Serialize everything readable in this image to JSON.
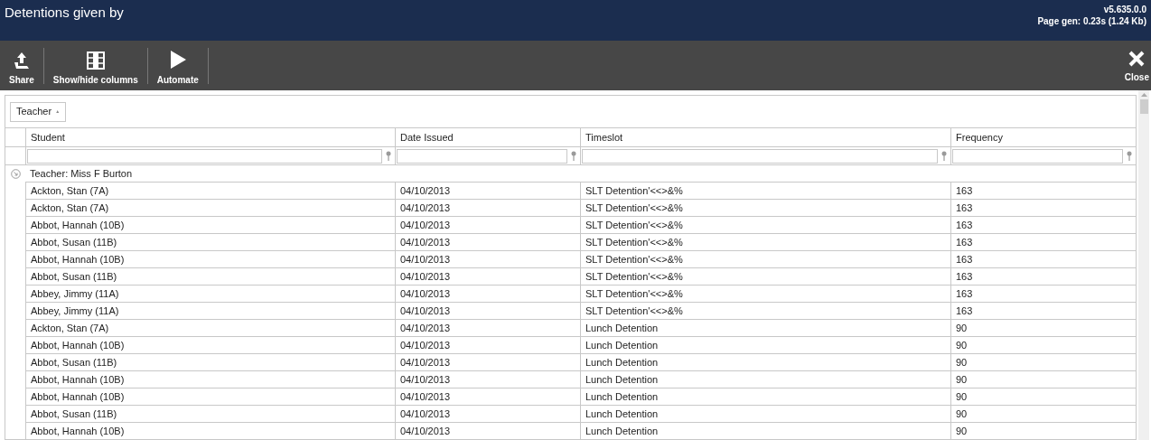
{
  "header": {
    "title": "Detentions given by",
    "version": "v5.635.0.0",
    "page_gen": "Page gen: 0.23s (1.24 Kb)"
  },
  "toolbar": {
    "buttons": [
      {
        "label": "Share",
        "kind": "share"
      },
      {
        "label": "Show/hide columns",
        "kind": "columns"
      },
      {
        "label": "Automate",
        "kind": "play"
      }
    ],
    "close": "Close"
  },
  "group_by": {
    "label": "Teacher",
    "caret": "▲"
  },
  "table": {
    "columns": [
      "Student",
      "Date Issued",
      "Timeslot",
      "Frequency"
    ],
    "group": {
      "label": "Teacher: Miss F Burton",
      "expanded": true
    },
    "rows": [
      [
        "Ackton, Stan (7A)",
        "04/10/2013",
        "SLT Detention'<<>&%",
        "163"
      ],
      [
        "Ackton, Stan (7A)",
        "04/10/2013",
        "SLT Detention'<<>&%",
        "163"
      ],
      [
        "Abbot, Hannah (10B)",
        "04/10/2013",
        "SLT Detention'<<>&%",
        "163"
      ],
      [
        "Abbot, Susan (11B)",
        "04/10/2013",
        "SLT Detention'<<>&%",
        "163"
      ],
      [
        "Abbot, Hannah (10B)",
        "04/10/2013",
        "SLT Detention'<<>&%",
        "163"
      ],
      [
        "Abbot, Susan (11B)",
        "04/10/2013",
        "SLT Detention'<<>&%",
        "163"
      ],
      [
        "Abbey, Jimmy (11A)",
        "04/10/2013",
        "SLT Detention'<<>&%",
        "163"
      ],
      [
        "Abbey, Jimmy (11A)",
        "04/10/2013",
        "SLT Detention'<<>&%",
        "163"
      ],
      [
        "Ackton, Stan (7A)",
        "04/10/2013",
        "Lunch Detention",
        "90"
      ],
      [
        "Abbot, Hannah (10B)",
        "04/10/2013",
        "Lunch Detention",
        "90"
      ],
      [
        "Abbot, Susan (11B)",
        "04/10/2013",
        "Lunch Detention",
        "90"
      ],
      [
        "Abbot, Hannah (10B)",
        "04/10/2013",
        "Lunch Detention",
        "90"
      ],
      [
        "Abbot, Hannah (10B)",
        "04/10/2013",
        "Lunch Detention",
        "90"
      ],
      [
        "Abbot, Susan (11B)",
        "04/10/2013",
        "Lunch Detention",
        "90"
      ],
      [
        "Abbot, Hannah (10B)",
        "04/10/2013",
        "Lunch Detention",
        "90"
      ]
    ]
  }
}
